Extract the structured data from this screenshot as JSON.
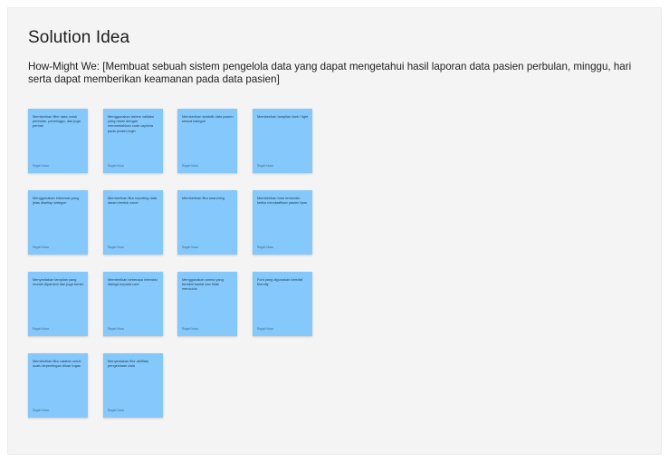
{
  "board": {
    "title": "Solution Idea",
    "hmw": "How-Might We: [Membuat sebuah sistem pengelola data yang dapat mengetahui hasil laporan data pasien perbulan, minggu, hari serta dapat memberikan keamanan pada data pasien]"
  },
  "colors": {
    "sticky": "#85c8fb",
    "background": "#f4f4f4"
  },
  "stickies": [
    {
      "text": "Memberikan filter data untuk perbulan, perminggu, dan juga perhari",
      "author": "Ragah Nusa"
    },
    {
      "text": "Menggunakan sistem validasi yang resmi dengan menambahkan code captcha pada proses login",
      "author": "Ragah Nusa"
    },
    {
      "text": "Memberikan statistik data pasien sesuai kategori",
      "author": "Ragah Nusa"
    },
    {
      "text": "Memberikan tampilan dark / light",
      "author": "Ragah Nusa"
    },
    {
      "text": "Menggunakan informasi yang jelas disetiap kategori",
      "author": "Ragah Nusa"
    },
    {
      "text": "Memberikan fitur reporting data dalam bentuk excel",
      "author": "Ragah Nusa"
    },
    {
      "text": "Memberikan fitur searching",
      "author": "Ragah Nusa"
    },
    {
      "text": "Memberikan form tersendiri ketika mendaaftkan pasien baru",
      "author": "Ragah Nusa"
    },
    {
      "text": "Menyediakan tampilan yang mudah dipahami dan juga bersih",
      "author": "Ragah Nusa"
    },
    {
      "text": "Memberikan beberapa Interaksi dialogs kepada user",
      "author": "Ragah Nusa"
    },
    {
      "text": "Menggunakan warna yang bersifat santai dan tidak mencolok",
      "author": "Ragah Nusa"
    },
    {
      "text": "Font yang digunakan bersifat friendly",
      "author": "Ragah Nusa"
    },
    {
      "text": "Memberikan fitur catatan untuk suatu kepentingan diluar tugas",
      "author": "Ragah Nusa"
    },
    {
      "text": "Menyediakan fitur aktifitas pengelolaan data",
      "author": "Ragah Nusa"
    }
  ]
}
